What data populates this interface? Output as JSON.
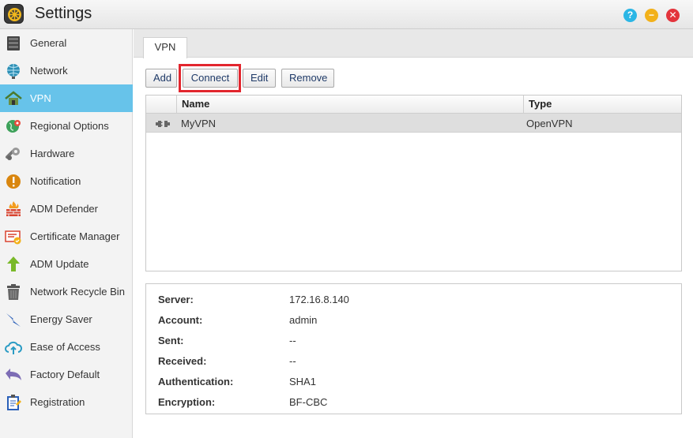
{
  "window": {
    "title": "Settings",
    "help_glyph": "?",
    "min_glyph": "−",
    "close_glyph": "✕"
  },
  "sidebar": {
    "items": [
      {
        "label": "General",
        "icon": "server-icon"
      },
      {
        "label": "Network",
        "icon": "globe-icon"
      },
      {
        "label": "VPN",
        "icon": "vpn-house-icon",
        "active": true
      },
      {
        "label": "Regional Options",
        "icon": "region-globe-icon"
      },
      {
        "label": "Hardware",
        "icon": "wrench-gear-icon"
      },
      {
        "label": "Notification",
        "icon": "alert-icon"
      },
      {
        "label": "ADM Defender",
        "icon": "firewall-icon"
      },
      {
        "label": "Certificate Manager",
        "icon": "certificate-icon"
      },
      {
        "label": "ADM Update",
        "icon": "up-arrow-icon"
      },
      {
        "label": "Network Recycle Bin",
        "icon": "trash-icon"
      },
      {
        "label": "Energy Saver",
        "icon": "lightning-icon"
      },
      {
        "label": "Ease of Access",
        "icon": "cloud-upload-icon"
      },
      {
        "label": "Factory Default",
        "icon": "undo-arrow-icon"
      },
      {
        "label": "Registration",
        "icon": "clipboard-icon"
      }
    ]
  },
  "tabs": [
    {
      "label": "VPN",
      "active": true
    }
  ],
  "toolbar": {
    "add_label": "Add",
    "connect_label": "Connect",
    "edit_label": "Edit",
    "remove_label": "Remove"
  },
  "grid": {
    "columns": [
      "Name",
      "Type"
    ],
    "rows": [
      {
        "name": "MyVPN",
        "type": "OpenVPN",
        "icon": "disconnected-plug-icon",
        "selected": true
      }
    ]
  },
  "details": [
    {
      "label": "Server:",
      "value": "172.16.8.140"
    },
    {
      "label": "Account:",
      "value": "admin"
    },
    {
      "label": "Sent:",
      "value": "--"
    },
    {
      "label": "Received:",
      "value": "--"
    },
    {
      "label": "Authentication:",
      "value": "SHA1"
    },
    {
      "label": "Encryption:",
      "value": "BF-CBC"
    }
  ],
  "colors": {
    "accent": "#67c3ea",
    "highlight_border": "#e2262e",
    "button_text": "#1f3a68"
  }
}
